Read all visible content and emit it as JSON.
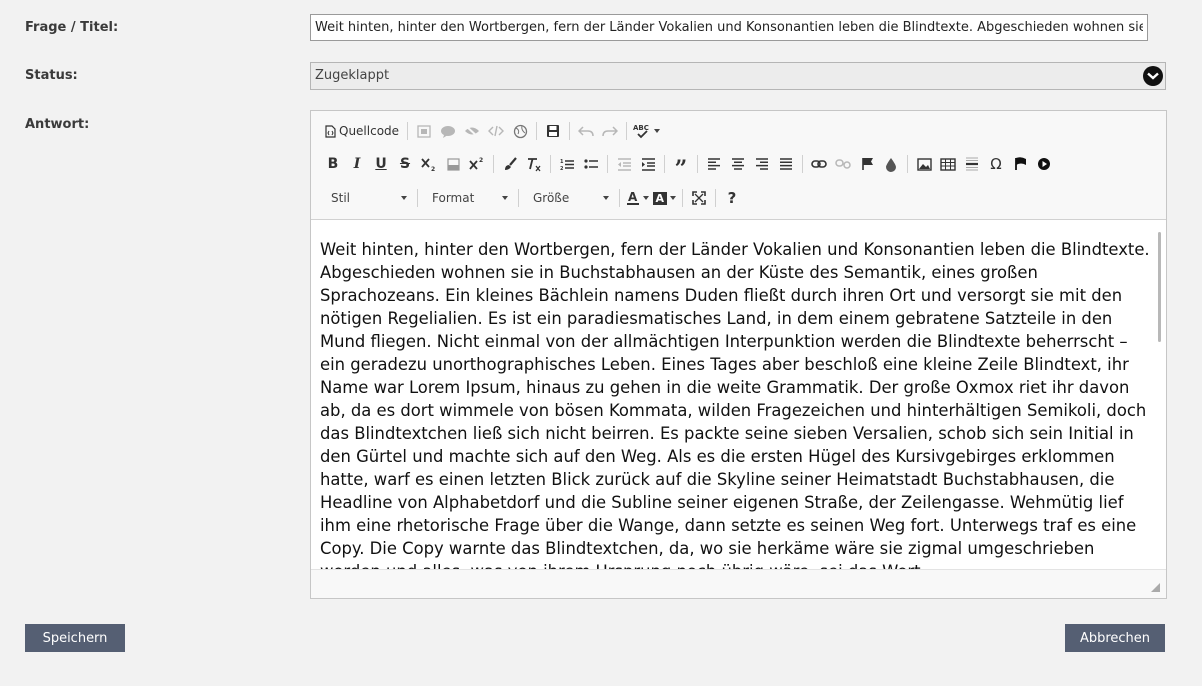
{
  "form": {
    "title_label": "Frage / Titel:",
    "title_value": "Weit hinten, hinter den Wortbergen, fern der Länder Vokalien und Konsonantien leben die Blindtexte. Abgeschieden wohnen sie in Buchstabhausen an der Küste des Semantik, eines großen Sprachozeans.",
    "status_label": "Status:",
    "status_value": "Zugeklappt",
    "answer_label": "Antwort:"
  },
  "editor": {
    "source_label": "Quellcode",
    "style_label": "Stil",
    "format_label": "Format",
    "size_label": "Größe",
    "body_text": "Weit hinten, hinter den Wortbergen, fern der Länder Vokalien und Konsonantien leben die Blindtexte. Abgeschieden wohnen sie in Buchstabhausen an der Küste des Semantik, eines großen Sprachozeans. Ein kleines Bächlein namens Duden fließt durch ihren Ort und versorgt sie mit den nötigen Regelialien. Es ist ein paradiesmatisches Land, in dem einem gebratene Satzteile in den Mund fliegen. Nicht einmal von der allmächtigen Interpunktion werden die Blindtexte beherrscht – ein geradezu unorthographisches Leben. Eines Tages aber beschloß eine kleine Zeile Blindtext, ihr Name war Lorem Ipsum, hinaus zu gehen in die weite Grammatik. Der große Oxmox riet ihr davon ab, da es dort wimmele von bösen Kommata, wilden Fragezeichen und hinterhältigen Semikoli, doch das Blindtextchen ließ sich nicht beirren. Es packte seine sieben Versalien, schob sich sein Initial in den Gürtel und machte sich auf den Weg. Als es die ersten Hügel des Kursivgebirges erklommen hatte, warf es einen letzten Blick zurück auf die Skyline seiner Heimatstadt Buchstabhausen, die Headline von Alphabetdorf und die Subline seiner eigenen Straße, der Zeilengasse. Wehmütig lief ihm eine rhetorische Frage über die Wange, dann setzte es seinen Weg fort. Unterwegs traf es eine Copy. Die Copy warnte das Blindtextchen, da, wo sie herkäme wäre sie zigmal umgeschrieben worden und alles, was von ihrem Ursprung noch übrig wäre, sei das Wort."
  },
  "actions": {
    "save_label": "Speichern",
    "cancel_label": "Abbrechen"
  },
  "colors": {
    "button_bg": "#555f73",
    "page_bg": "#f2f2f2"
  }
}
